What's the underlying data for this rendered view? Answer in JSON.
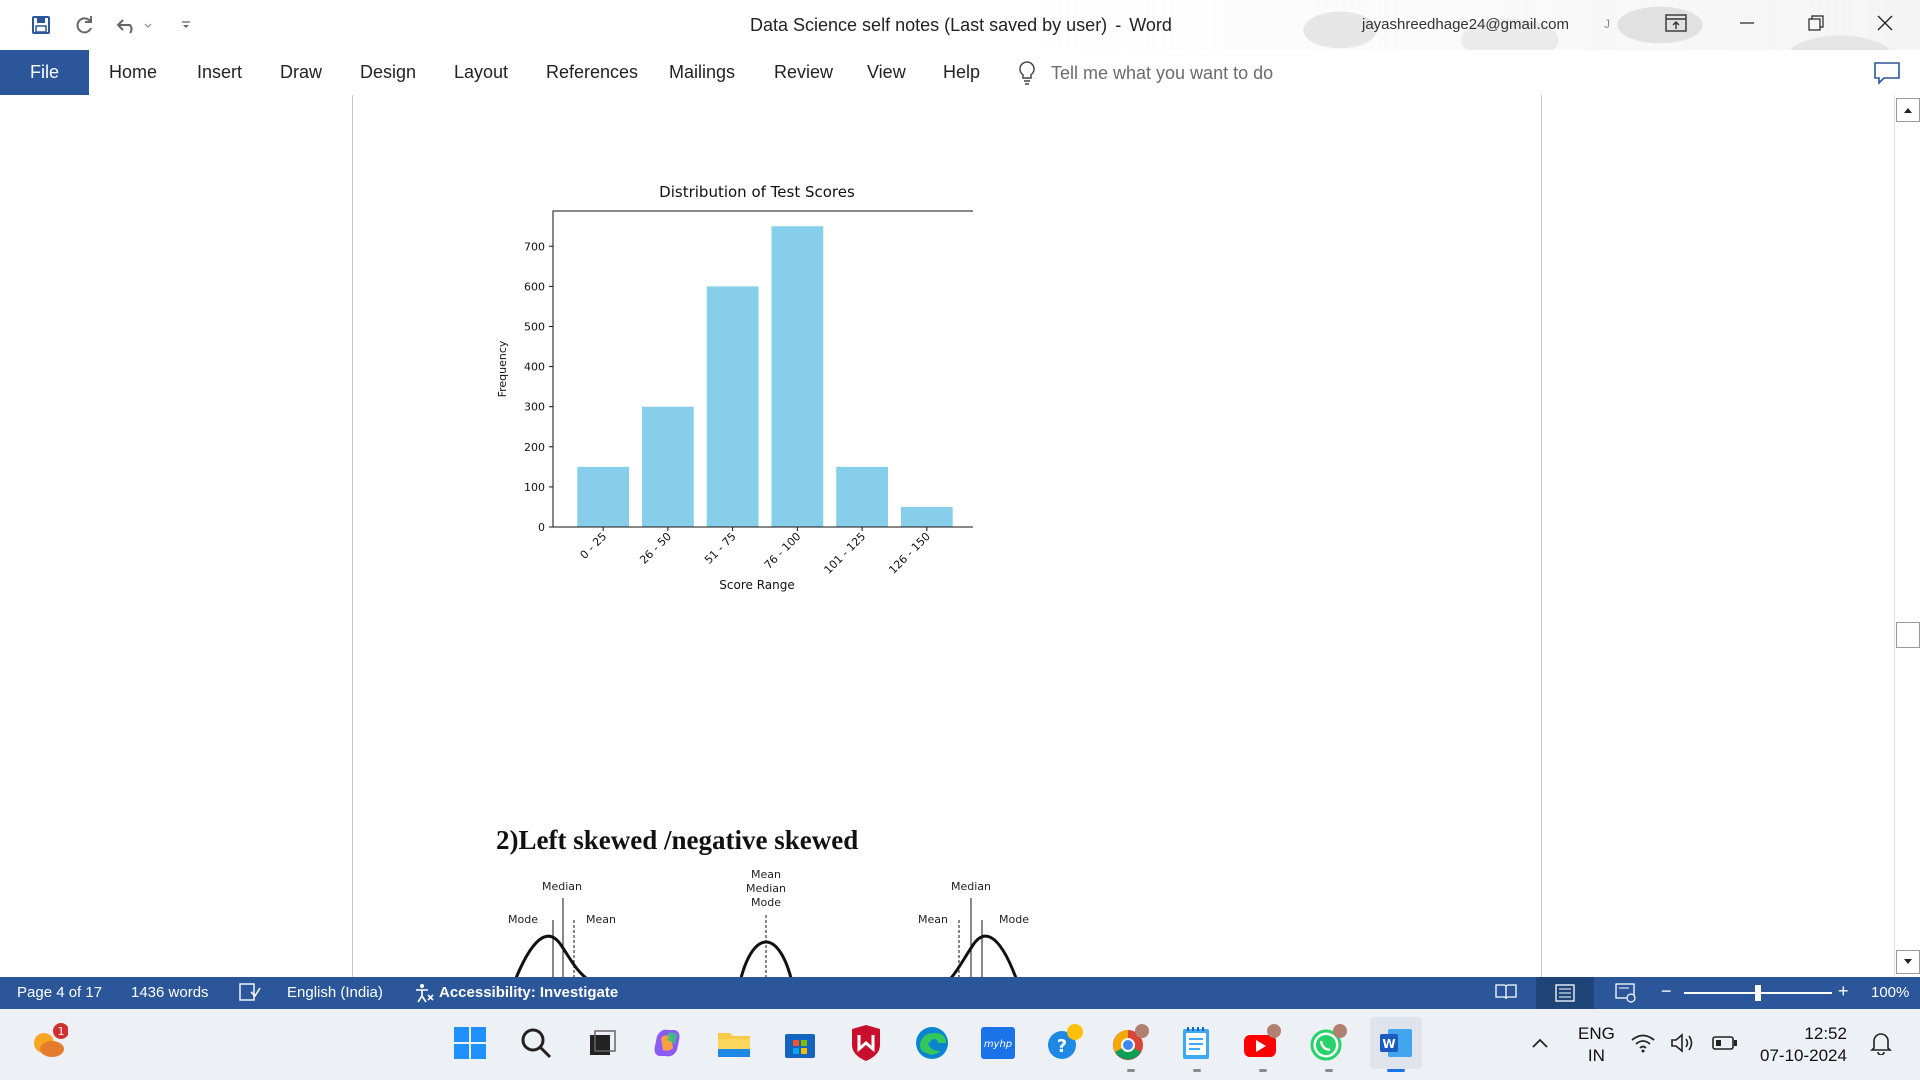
{
  "window": {
    "doc_title": "Data Science self notes (Last saved by user)",
    "separator": "-",
    "app_name": "Word",
    "user_email": "jayashreedhage24@gmail.com",
    "user_initial": "J"
  },
  "ribbon": {
    "file": "File",
    "tabs": [
      "Home",
      "Insert",
      "Draw",
      "Design",
      "Layout",
      "References",
      "Mailings",
      "Review",
      "View",
      "Help"
    ],
    "tell_me": "Tell me what you want to do"
  },
  "document": {
    "heading": "2)Left skewed /negative skewed",
    "skew_labels": {
      "fig1_median": "Median",
      "fig1_mode": "Mode",
      "fig1_mean": "Mean",
      "fig2_mean": "Mean",
      "fig2_median": "Median",
      "fig2_mode": "Mode",
      "fig3_median": "Median",
      "fig3_mean": "Mean",
      "fig3_mode": "Mode"
    }
  },
  "chart_data": {
    "type": "bar",
    "title": "Distribution of Test Scores",
    "xlabel": "Score Range",
    "ylabel": "Frequency",
    "categories": [
      "0 - 25",
      "26 - 50",
      "51 - 75",
      "76 - 100",
      "101 - 125",
      "126 - 150"
    ],
    "values": [
      150,
      300,
      600,
      750,
      150,
      50
    ],
    "yticks": [
      0,
      100,
      200,
      300,
      400,
      500,
      600,
      700
    ],
    "ylim": [
      0,
      788
    ],
    "bar_color": "#87ceeb",
    "grid": false
  },
  "statusbar": {
    "page": "Page 4 of 17",
    "words": "1436 words",
    "language": "English (India)",
    "accessibility": "Accessibility: Investigate",
    "zoom": "100%",
    "zoom_minus": "−",
    "zoom_plus": "+"
  },
  "taskbar": {
    "notification_badge": "1",
    "myhp_label": "myhp",
    "lang_line1": "ENG",
    "lang_line2": "IN",
    "time": "12:52",
    "date": "07-10-2024"
  },
  "colors": {
    "accent": "#2b579a",
    "taskbar_bg": "#edf0f5"
  }
}
